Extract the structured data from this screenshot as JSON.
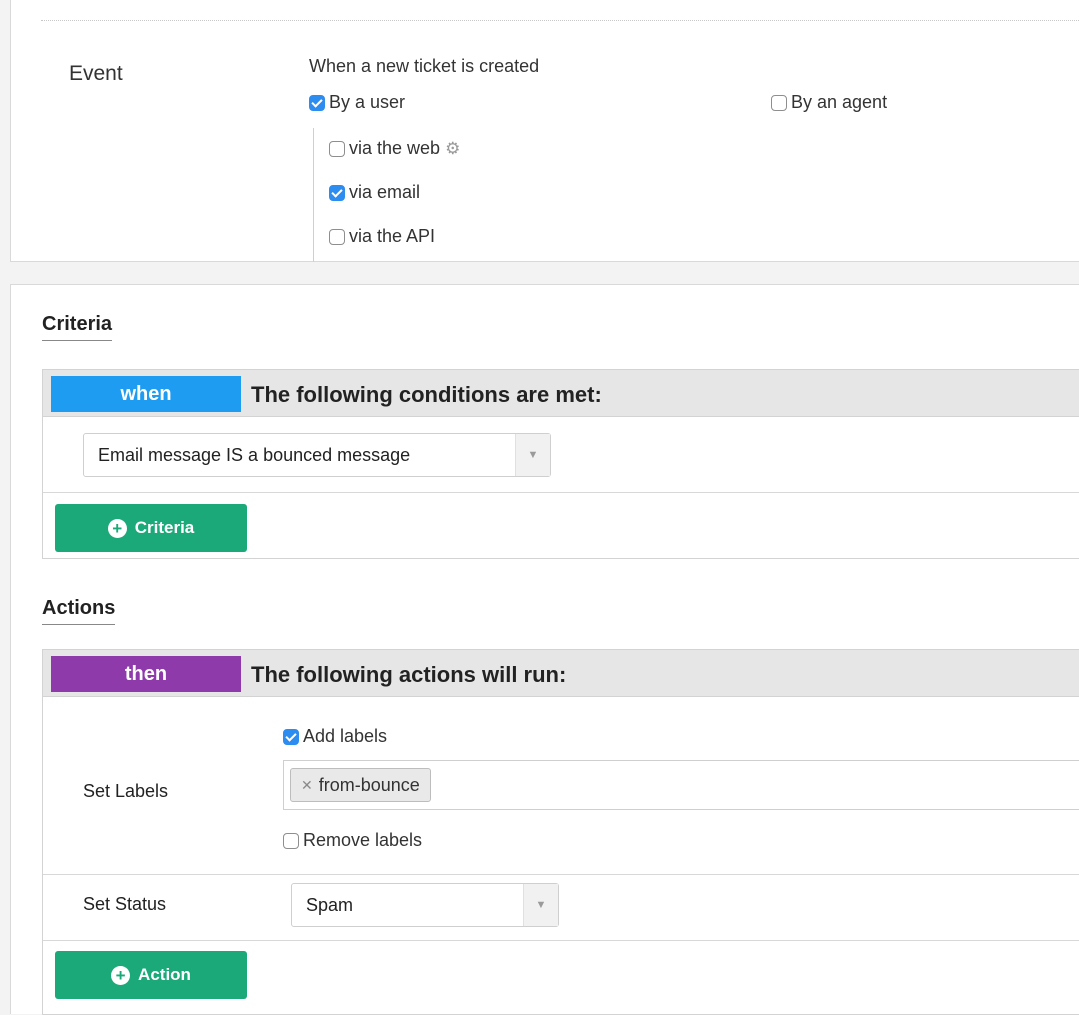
{
  "event": {
    "label": "Event",
    "title": "When a new ticket is created",
    "by_user": {
      "label": "By a user",
      "checked": true
    },
    "by_agent": {
      "label": "By an agent",
      "checked": false
    },
    "via": [
      {
        "label": "via the web",
        "checked": false,
        "icon": "gear-icon"
      },
      {
        "label": "via email",
        "checked": true
      },
      {
        "label": "via the API",
        "checked": false
      }
    ]
  },
  "criteria": {
    "section_title": "Criteria",
    "pill": "when",
    "header": "The following conditions are met:",
    "condition_value": "Email message IS a bounced message",
    "add_button": "Criteria",
    "colors": {
      "pill": "#1e9cf2",
      "button": "#1ba97a"
    }
  },
  "actions": {
    "section_title": "Actions",
    "pill": "then",
    "header": "The following actions will run:",
    "set_labels": {
      "label": "Set Labels",
      "add_labels": {
        "label": "Add labels",
        "checked": true
      },
      "tags": [
        "from-bounce"
      ],
      "remove_labels": {
        "label": "Remove labels",
        "checked": false
      }
    },
    "set_status": {
      "label": "Set Status",
      "value": "Spam"
    },
    "add_button": "Action",
    "colors": {
      "pill": "#8e3aab",
      "button": "#1ba97a"
    }
  }
}
